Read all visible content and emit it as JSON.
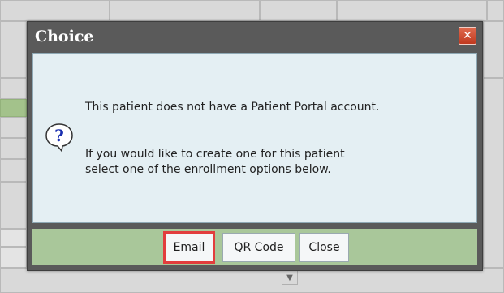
{
  "dialog": {
    "title": "Choice",
    "close_icon": "close-icon",
    "message_line1": "This patient does not have a Patient Portal account.",
    "message_line2": "If you would like to create one for this patient",
    "message_line3": "select one of the enrollment options below.",
    "icon": "question-icon",
    "buttons": {
      "email": "Email",
      "qr_code": "QR Code",
      "close": "Close"
    },
    "highlight_color": "#e23d3d"
  },
  "background": {
    "dropdown_icon": "chevron-down-icon"
  }
}
